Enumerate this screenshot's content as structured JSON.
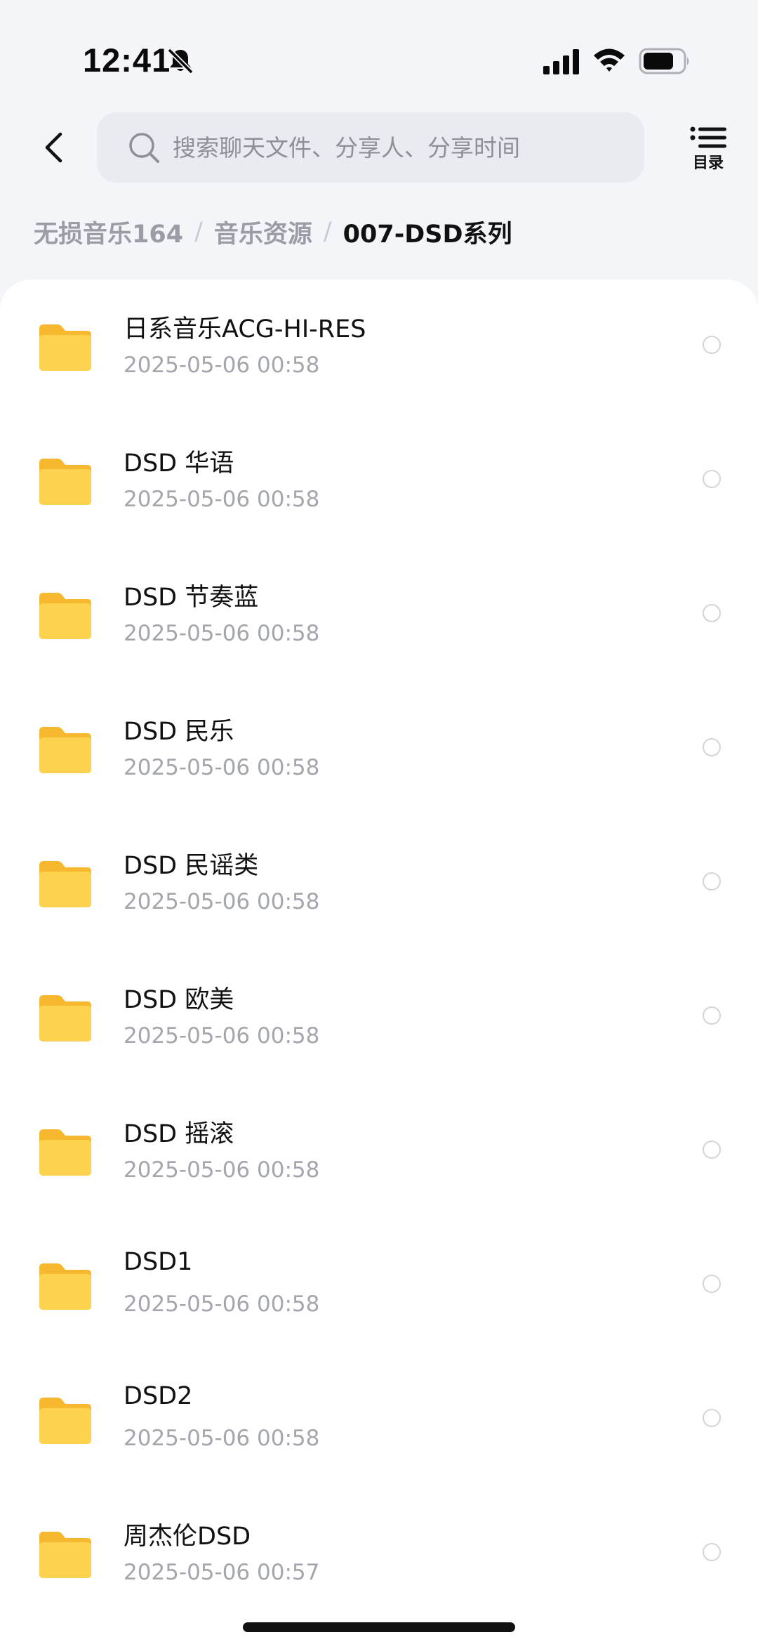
{
  "status_bar": {
    "time": "12:41",
    "icons": [
      "bell-slash-icon",
      "cellular-signal-icon",
      "wifi-icon",
      "battery-icon"
    ]
  },
  "header": {
    "back_icon": "chevron-left-icon",
    "search": {
      "placeholder": "搜索聊天文件、分享人、分享时间",
      "icon": "search-icon"
    },
    "toc": {
      "label": "目录",
      "icon": "list-icon"
    }
  },
  "breadcrumb": {
    "items": [
      "无损音乐164",
      "音乐资源"
    ],
    "separator": "/",
    "current": "007-DSD系列"
  },
  "files": [
    {
      "name": "日系音乐ACG-HI-RES",
      "date": "2025-05-06 00:58",
      "icon": "folder-icon",
      "selected": false
    },
    {
      "name": "DSD 华语",
      "date": "2025-05-06 00:58",
      "icon": "folder-icon",
      "selected": false
    },
    {
      "name": "DSD 节奏蓝",
      "date": "2025-05-06 00:58",
      "icon": "folder-icon",
      "selected": false
    },
    {
      "name": "DSD 民乐",
      "date": "2025-05-06 00:58",
      "icon": "folder-icon",
      "selected": false
    },
    {
      "name": "DSD 民谣类",
      "date": "2025-05-06 00:58",
      "icon": "folder-icon",
      "selected": false
    },
    {
      "name": "DSD 欧美",
      "date": "2025-05-06 00:58",
      "icon": "folder-icon",
      "selected": false
    },
    {
      "name": "DSD 摇滚",
      "date": "2025-05-06 00:58",
      "icon": "folder-icon",
      "selected": false
    },
    {
      "name": "DSD1",
      "date": "2025-05-06 00:58",
      "icon": "folder-icon",
      "selected": false
    },
    {
      "name": "DSD2",
      "date": "2025-05-06 00:58",
      "icon": "folder-icon",
      "selected": false
    },
    {
      "name": "周杰伦DSD",
      "date": "2025-05-06 00:57",
      "icon": "folder-icon",
      "selected": false
    }
  ],
  "colors": {
    "background": "#f4f5f9",
    "panel": "#ffffff",
    "folder": "#fcc93a",
    "muted_text": "#a4a6ae",
    "search_bg": "#eaebf1"
  }
}
